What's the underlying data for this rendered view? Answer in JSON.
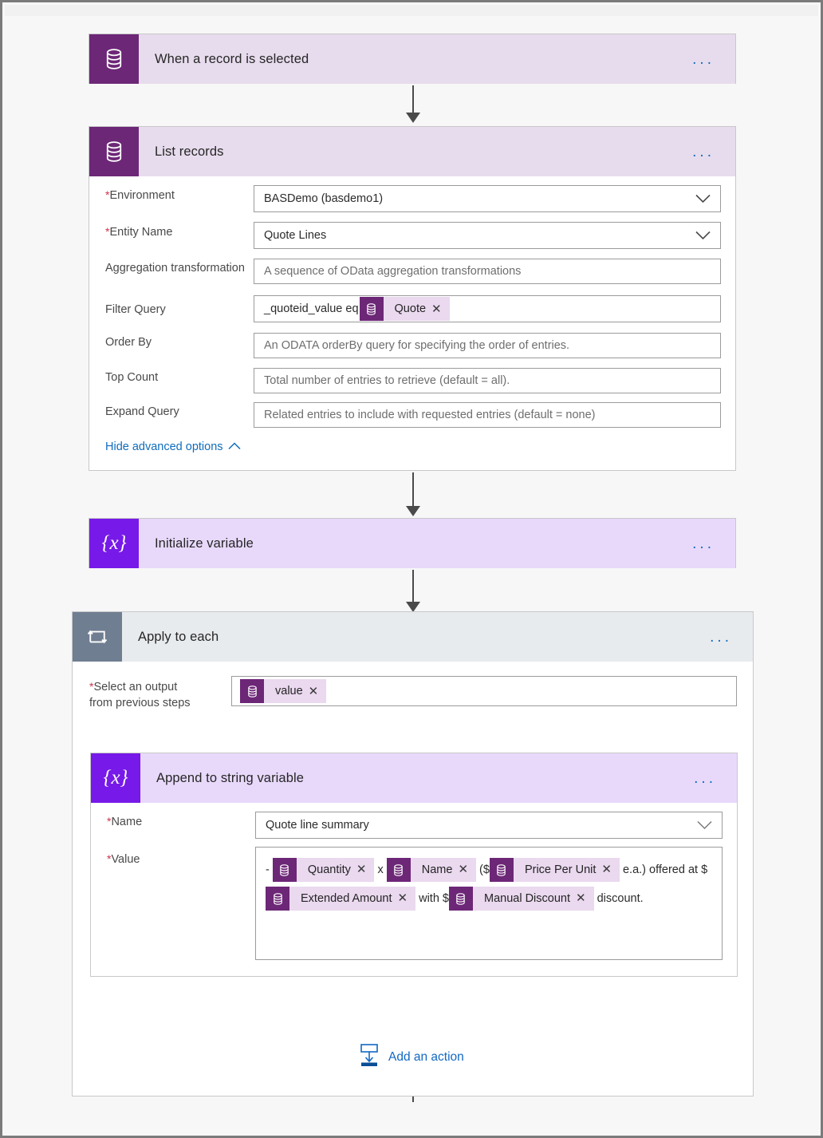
{
  "flow": {
    "steps": [
      {
        "id": "trigger",
        "title": "When a record is selected",
        "icon": "dataverse-icon",
        "menu": "..."
      },
      {
        "id": "list-records",
        "title": "List records",
        "icon": "dataverse-icon",
        "menu": "...",
        "fields": [
          {
            "label": "Environment",
            "required": true,
            "value": "BASDemo (basdemo1)",
            "control": "dropdown"
          },
          {
            "label": "Entity Name",
            "required": true,
            "value": "Quote Lines",
            "control": "dropdown"
          },
          {
            "label": "Aggregation transformation",
            "required": false,
            "placeholder": "A sequence of OData aggregation transformations",
            "control": "text"
          },
          {
            "label": "Filter Query",
            "required": false,
            "prefix": "_quoteid_value eq",
            "token": "Quote",
            "control": "token-text"
          },
          {
            "label": "Order By",
            "required": false,
            "placeholder": "An ODATA orderBy query for specifying the order of entries.",
            "control": "text"
          },
          {
            "label": "Top Count",
            "required": false,
            "placeholder": "Total number of entries to retrieve (default = all).",
            "control": "text"
          },
          {
            "label": "Expand Query",
            "required": false,
            "placeholder": "Related entries to include with requested entries (default = none)",
            "control": "text"
          }
        ],
        "advanced_link": "Hide advanced options",
        "advanced_caret": "chevron-up"
      },
      {
        "id": "initialize-variable",
        "title": "Initialize variable",
        "icon": "variable-icon",
        "menu": "..."
      },
      {
        "id": "apply-to-each",
        "title": "Apply to each",
        "icon": "loop-icon",
        "menu": "...",
        "select_output": {
          "label_line1": "Select an output",
          "label_line2": "from previous steps",
          "required": true,
          "token": "value"
        },
        "inner_step": {
          "id": "append-to-string-variable",
          "title": "Append to string variable",
          "icon": "variable-icon",
          "menu": "...",
          "name_field": {
            "label": "Name",
            "required": true,
            "value": "Quote line summary",
            "control": "dropdown"
          },
          "value_field": {
            "label": "Value",
            "required": true,
            "parts": [
              {
                "type": "text",
                "text": "- "
              },
              {
                "type": "token",
                "text": "Quantity"
              },
              {
                "type": "text",
                "text": " x "
              },
              {
                "type": "token",
                "text": "Name"
              },
              {
                "type": "text",
                "text": " ($"
              },
              {
                "type": "token",
                "text": "Price Per Unit"
              },
              {
                "type": "text",
                "text": " e.a.) "
              },
              {
                "type": "text",
                "text": "offered at $"
              },
              {
                "type": "token",
                "text": "Extended Amount"
              },
              {
                "type": "text",
                "text": " with $"
              },
              {
                "type": "token",
                "text": "Manual Discount"
              },
              {
                "type": "text",
                "text": " discount."
              }
            ]
          }
        },
        "add_action": {
          "label": "Add an action",
          "icon": "add-action-icon"
        }
      }
    ]
  },
  "colors": {
    "dataverse_icon_bg": "#6d2777",
    "dataverse_header_bg": "#e7dced",
    "variable_icon_bg": "#7719e8",
    "variable_header_bg": "#e8d9fb",
    "loop_icon_bg": "#6f7e91",
    "loop_header_bg": "#e8ebee",
    "link_blue": "#0f6cbd",
    "required_red": "#d0304b",
    "token_bg": "#ead9ef",
    "arrow_gray": "#4a4a4a",
    "page_bg": "#f7f7f7"
  }
}
